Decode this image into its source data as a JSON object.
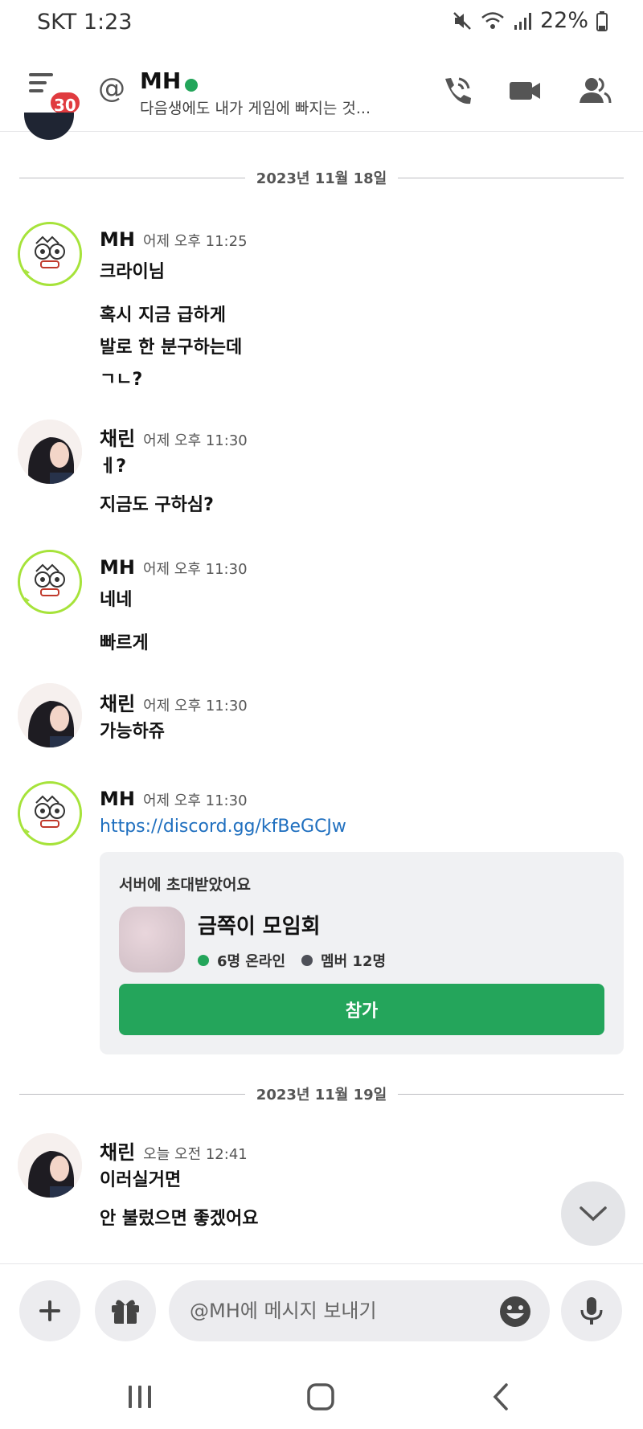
{
  "status_bar": {
    "carrier_time": "SKT 1:23",
    "battery": "22%"
  },
  "header": {
    "badge_count": "30",
    "at_symbol": "@",
    "name": "MH",
    "status": "다음생에도 내가 게임에 빠지는 것...",
    "icons": [
      "hamburger-menu-icon",
      "call-icon",
      "video-icon",
      "members-icon"
    ]
  },
  "chat": {
    "divider1": "2023년 11월 18일",
    "m1": {
      "author": "MH",
      "time": "어제 오후 11:25",
      "lines": [
        "크라이님",
        "혹시 지금 급하게",
        "발로 한 분구하는데",
        "ㄱㄴ?"
      ]
    },
    "m2": {
      "author": "채린",
      "time": "어제 오후 11:30",
      "lines": [
        "ㅔ?",
        "지금도 구하심?"
      ]
    },
    "m3": {
      "author": "MH",
      "time": "어제 오후 11:30",
      "lines": [
        "네네",
        "빠르게"
      ]
    },
    "m4": {
      "author": "채린",
      "time": "어제 오후 11:30",
      "lines": [
        "가능하쥬"
      ]
    },
    "m5": {
      "author": "MH",
      "time": "어제 오후 11:30",
      "link": "https://discord.gg/kfBeGCJw"
    },
    "invite": {
      "title": "서버에 초대받았어요",
      "server": "금쪽이 모임회",
      "online": "6명 온라인",
      "members": "멤버 12명",
      "join": "참가",
      "online_color": "#23a55a",
      "members_color": "#4e5058"
    },
    "divider2": "2023년 11월 19일",
    "m6": {
      "author": "채린",
      "time": "오늘 오전 12:41",
      "lines": [
        "이러실거면",
        "안 불렀으면 좋겠어요"
      ]
    }
  },
  "composer": {
    "placeholder": "@MH에 메시지 보내기"
  },
  "colors": {
    "accent_green": "#24a55b",
    "badge_red": "#e03b3f",
    "link_blue": "#1f6fbf"
  }
}
